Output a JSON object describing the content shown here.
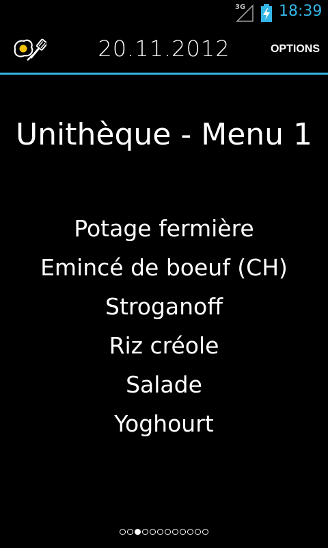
{
  "status_bar": {
    "network_type": "3G",
    "time": "18:39",
    "battery_icon": "battery-charging-icon",
    "signal_icon": "signal-icon",
    "time_color": "#33b5e5"
  },
  "action_bar": {
    "app_icon": "egg-spatula-icon",
    "date": "20.11.2012",
    "options_label": "OPTIONS",
    "divider_color": "#33b5e5"
  },
  "menu": {
    "title": "Unithèque - Menu 1",
    "items": [
      "Potage fermière",
      "Emincé de boeuf (CH)",
      "Stroganoff",
      "Riz créole",
      "Salade",
      "Yoghourt"
    ]
  },
  "pager": {
    "total_pages": 12,
    "current_page": 3
  }
}
